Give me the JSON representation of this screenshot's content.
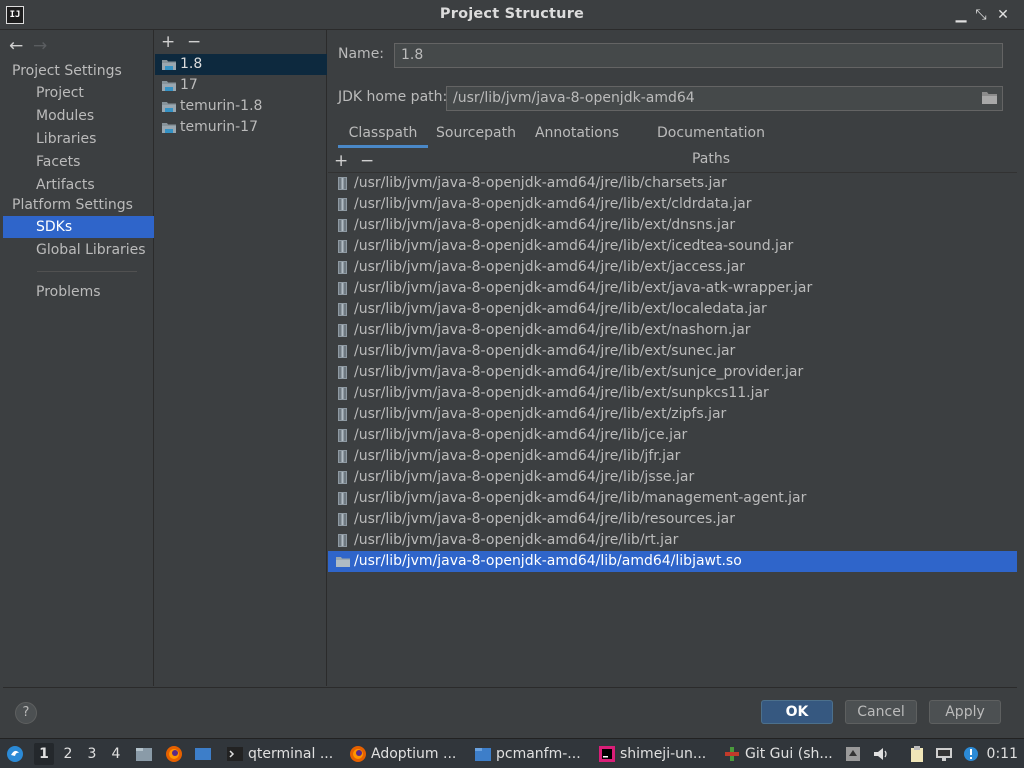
{
  "window": {
    "title": "Project Structure",
    "app_icon_text": "IJ"
  },
  "controls": {
    "minimize": "▁",
    "restore": "⤡",
    "close": "✕"
  },
  "nav": {
    "back": "←",
    "forward": "→",
    "project_settings_header": "Project Settings",
    "project_settings": [
      "Project",
      "Modules",
      "Libraries",
      "Facets",
      "Artifacts"
    ],
    "platform_settings_header": "Platform Settings",
    "platform_settings": [
      "SDKs",
      "Global Libraries"
    ],
    "problems": "Problems",
    "selected": "SDKs"
  },
  "sdk_list": {
    "add": "+",
    "remove": "−",
    "items": [
      "1.8",
      "17",
      "temurin-1.8",
      "temurin-17"
    ],
    "selected": "1.8"
  },
  "sdk_details": {
    "name_label": "Name:",
    "name_value": "1.8",
    "home_label": "JDK home path:",
    "home_value": "/usr/lib/jvm/java-8-openjdk-amd64",
    "tabs": [
      "Classpath",
      "Sourcepath",
      "Annotations",
      "Documentation Paths"
    ],
    "active_tab": "Classpath",
    "add": "+",
    "remove": "−",
    "classpath": [
      "/usr/lib/jvm/java-8-openjdk-amd64/jre/lib/charsets.jar",
      "/usr/lib/jvm/java-8-openjdk-amd64/jre/lib/ext/cldrdata.jar",
      "/usr/lib/jvm/java-8-openjdk-amd64/jre/lib/ext/dnsns.jar",
      "/usr/lib/jvm/java-8-openjdk-amd64/jre/lib/ext/icedtea-sound.jar",
      "/usr/lib/jvm/java-8-openjdk-amd64/jre/lib/ext/jaccess.jar",
      "/usr/lib/jvm/java-8-openjdk-amd64/jre/lib/ext/java-atk-wrapper.jar",
      "/usr/lib/jvm/java-8-openjdk-amd64/jre/lib/ext/localedata.jar",
      "/usr/lib/jvm/java-8-openjdk-amd64/jre/lib/ext/nashorn.jar",
      "/usr/lib/jvm/java-8-openjdk-amd64/jre/lib/ext/sunec.jar",
      "/usr/lib/jvm/java-8-openjdk-amd64/jre/lib/ext/sunjce_provider.jar",
      "/usr/lib/jvm/java-8-openjdk-amd64/jre/lib/ext/sunpkcs11.jar",
      "/usr/lib/jvm/java-8-openjdk-amd64/jre/lib/ext/zipfs.jar",
      "/usr/lib/jvm/java-8-openjdk-amd64/jre/lib/jce.jar",
      "/usr/lib/jvm/java-8-openjdk-amd64/jre/lib/jfr.jar",
      "/usr/lib/jvm/java-8-openjdk-amd64/jre/lib/jsse.jar",
      "/usr/lib/jvm/java-8-openjdk-amd64/jre/lib/management-agent.jar",
      "/usr/lib/jvm/java-8-openjdk-amd64/jre/lib/resources.jar",
      "/usr/lib/jvm/java-8-openjdk-amd64/jre/lib/rt.jar",
      "/usr/lib/jvm/java-8-openjdk-amd64/lib/amd64/libjawt.so"
    ],
    "selected_classpath": "/usr/lib/jvm/java-8-openjdk-amd64/lib/amd64/libjawt.so"
  },
  "footer": {
    "help": "?",
    "ok": "OK",
    "cancel": "Cancel",
    "apply": "Apply"
  },
  "taskbar": {
    "desktops": [
      "1",
      "2",
      "3",
      "4"
    ],
    "active_desktop": "1",
    "tasks": [
      "qterminal ...",
      "Adoptium ...",
      "pcmanfm-...",
      "shimeji-un...",
      "Git Gui (sh..."
    ],
    "clock": "0:11"
  },
  "colors": {
    "accent": "#2f65ca",
    "selection_inactive": "#0d293e",
    "tab_underline": "#4a88c7",
    "background": "#3c3f41"
  }
}
